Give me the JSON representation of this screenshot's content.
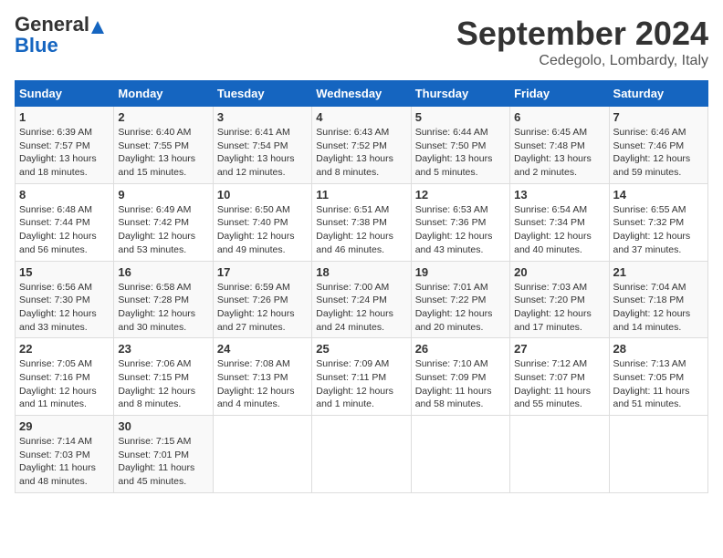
{
  "header": {
    "logo_general": "General",
    "logo_blue": "Blue",
    "month_title": "September 2024",
    "location": "Cedegolo, Lombardy, Italy"
  },
  "weekdays": [
    "Sunday",
    "Monday",
    "Tuesday",
    "Wednesday",
    "Thursday",
    "Friday",
    "Saturday"
  ],
  "weeks": [
    [
      {
        "day": "1",
        "lines": [
          "Sunrise: 6:39 AM",
          "Sunset: 7:57 PM",
          "Daylight: 13 hours",
          "and 18 minutes."
        ]
      },
      {
        "day": "2",
        "lines": [
          "Sunrise: 6:40 AM",
          "Sunset: 7:55 PM",
          "Daylight: 13 hours",
          "and 15 minutes."
        ]
      },
      {
        "day": "3",
        "lines": [
          "Sunrise: 6:41 AM",
          "Sunset: 7:54 PM",
          "Daylight: 13 hours",
          "and 12 minutes."
        ]
      },
      {
        "day": "4",
        "lines": [
          "Sunrise: 6:43 AM",
          "Sunset: 7:52 PM",
          "Daylight: 13 hours",
          "and 8 minutes."
        ]
      },
      {
        "day": "5",
        "lines": [
          "Sunrise: 6:44 AM",
          "Sunset: 7:50 PM",
          "Daylight: 13 hours",
          "and 5 minutes."
        ]
      },
      {
        "day": "6",
        "lines": [
          "Sunrise: 6:45 AM",
          "Sunset: 7:48 PM",
          "Daylight: 13 hours",
          "and 2 minutes."
        ]
      },
      {
        "day": "7",
        "lines": [
          "Sunrise: 6:46 AM",
          "Sunset: 7:46 PM",
          "Daylight: 12 hours",
          "and 59 minutes."
        ]
      }
    ],
    [
      {
        "day": "8",
        "lines": [
          "Sunrise: 6:48 AM",
          "Sunset: 7:44 PM",
          "Daylight: 12 hours",
          "and 56 minutes."
        ]
      },
      {
        "day": "9",
        "lines": [
          "Sunrise: 6:49 AM",
          "Sunset: 7:42 PM",
          "Daylight: 12 hours",
          "and 53 minutes."
        ]
      },
      {
        "day": "10",
        "lines": [
          "Sunrise: 6:50 AM",
          "Sunset: 7:40 PM",
          "Daylight: 12 hours",
          "and 49 minutes."
        ]
      },
      {
        "day": "11",
        "lines": [
          "Sunrise: 6:51 AM",
          "Sunset: 7:38 PM",
          "Daylight: 12 hours",
          "and 46 minutes."
        ]
      },
      {
        "day": "12",
        "lines": [
          "Sunrise: 6:53 AM",
          "Sunset: 7:36 PM",
          "Daylight: 12 hours",
          "and 43 minutes."
        ]
      },
      {
        "day": "13",
        "lines": [
          "Sunrise: 6:54 AM",
          "Sunset: 7:34 PM",
          "Daylight: 12 hours",
          "and 40 minutes."
        ]
      },
      {
        "day": "14",
        "lines": [
          "Sunrise: 6:55 AM",
          "Sunset: 7:32 PM",
          "Daylight: 12 hours",
          "and 37 minutes."
        ]
      }
    ],
    [
      {
        "day": "15",
        "lines": [
          "Sunrise: 6:56 AM",
          "Sunset: 7:30 PM",
          "Daylight: 12 hours",
          "and 33 minutes."
        ]
      },
      {
        "day": "16",
        "lines": [
          "Sunrise: 6:58 AM",
          "Sunset: 7:28 PM",
          "Daylight: 12 hours",
          "and 30 minutes."
        ]
      },
      {
        "day": "17",
        "lines": [
          "Sunrise: 6:59 AM",
          "Sunset: 7:26 PM",
          "Daylight: 12 hours",
          "and 27 minutes."
        ]
      },
      {
        "day": "18",
        "lines": [
          "Sunrise: 7:00 AM",
          "Sunset: 7:24 PM",
          "Daylight: 12 hours",
          "and 24 minutes."
        ]
      },
      {
        "day": "19",
        "lines": [
          "Sunrise: 7:01 AM",
          "Sunset: 7:22 PM",
          "Daylight: 12 hours",
          "and 20 minutes."
        ]
      },
      {
        "day": "20",
        "lines": [
          "Sunrise: 7:03 AM",
          "Sunset: 7:20 PM",
          "Daylight: 12 hours",
          "and 17 minutes."
        ]
      },
      {
        "day": "21",
        "lines": [
          "Sunrise: 7:04 AM",
          "Sunset: 7:18 PM",
          "Daylight: 12 hours",
          "and 14 minutes."
        ]
      }
    ],
    [
      {
        "day": "22",
        "lines": [
          "Sunrise: 7:05 AM",
          "Sunset: 7:16 PM",
          "Daylight: 12 hours",
          "and 11 minutes."
        ]
      },
      {
        "day": "23",
        "lines": [
          "Sunrise: 7:06 AM",
          "Sunset: 7:15 PM",
          "Daylight: 12 hours",
          "and 8 minutes."
        ]
      },
      {
        "day": "24",
        "lines": [
          "Sunrise: 7:08 AM",
          "Sunset: 7:13 PM",
          "Daylight: 12 hours",
          "and 4 minutes."
        ]
      },
      {
        "day": "25",
        "lines": [
          "Sunrise: 7:09 AM",
          "Sunset: 7:11 PM",
          "Daylight: 12 hours",
          "and 1 minute."
        ]
      },
      {
        "day": "26",
        "lines": [
          "Sunrise: 7:10 AM",
          "Sunset: 7:09 PM",
          "Daylight: 11 hours",
          "and 58 minutes."
        ]
      },
      {
        "day": "27",
        "lines": [
          "Sunrise: 7:12 AM",
          "Sunset: 7:07 PM",
          "Daylight: 11 hours",
          "and 55 minutes."
        ]
      },
      {
        "day": "28",
        "lines": [
          "Sunrise: 7:13 AM",
          "Sunset: 7:05 PM",
          "Daylight: 11 hours",
          "and 51 minutes."
        ]
      }
    ],
    [
      {
        "day": "29",
        "lines": [
          "Sunrise: 7:14 AM",
          "Sunset: 7:03 PM",
          "Daylight: 11 hours",
          "and 48 minutes."
        ]
      },
      {
        "day": "30",
        "lines": [
          "Sunrise: 7:15 AM",
          "Sunset: 7:01 PM",
          "Daylight: 11 hours",
          "and 45 minutes."
        ]
      },
      null,
      null,
      null,
      null,
      null
    ]
  ]
}
